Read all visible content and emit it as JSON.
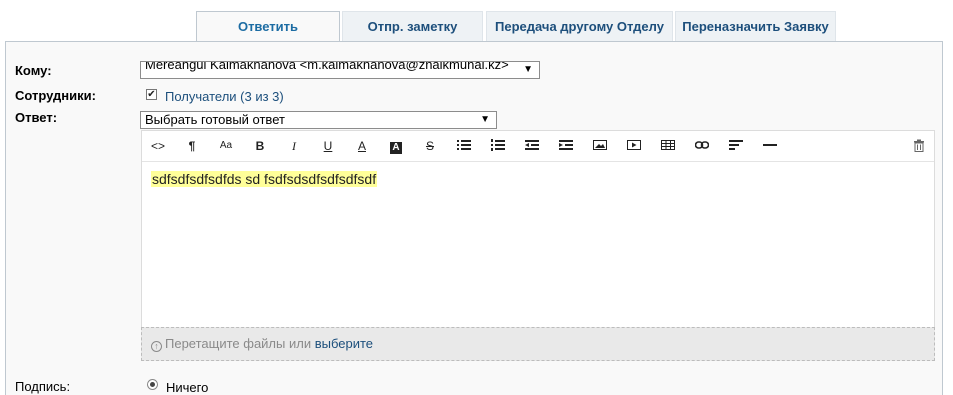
{
  "tabs": [
    {
      "label": "Ответить",
      "active": true
    },
    {
      "label": "Отпр. заметку",
      "active": false
    },
    {
      "label": "Передача другому Отделу",
      "active": false
    },
    {
      "label": "Переназначить Заявку",
      "active": false
    }
  ],
  "form": {
    "to_label": "Кому:",
    "to_value": "Mereangul Kaimaknanova <m.kaimaknanova@zhaikmunai.kz>",
    "staff_label": "Сотрудники:",
    "recipients_label": "Получатели (3 из 3)",
    "recipients_checked": true,
    "answer_label": "Ответ:",
    "canned_response": "Выбрать готовый ответ",
    "body_text": "sdfsdfsdfsdfds sd fsdfsdsdfsdfsdfsdf",
    "dropzone_text": "Перетащите файлы или",
    "dropzone_link": "выберите",
    "signature_label": "Подпись:",
    "signature_option": "Ничего"
  },
  "toolbar": [
    "code-view",
    "paragraph",
    "font-size",
    "bold",
    "italic",
    "underline",
    "font-color",
    "background-color",
    "strikethrough",
    "unordered-list",
    "ordered-list",
    "outdent",
    "indent",
    "image",
    "video",
    "table",
    "link",
    "align",
    "horizontal-rule",
    "delete"
  ],
  "colors": {
    "accent": "#1c6ca3",
    "highlight": "#ffff99"
  }
}
